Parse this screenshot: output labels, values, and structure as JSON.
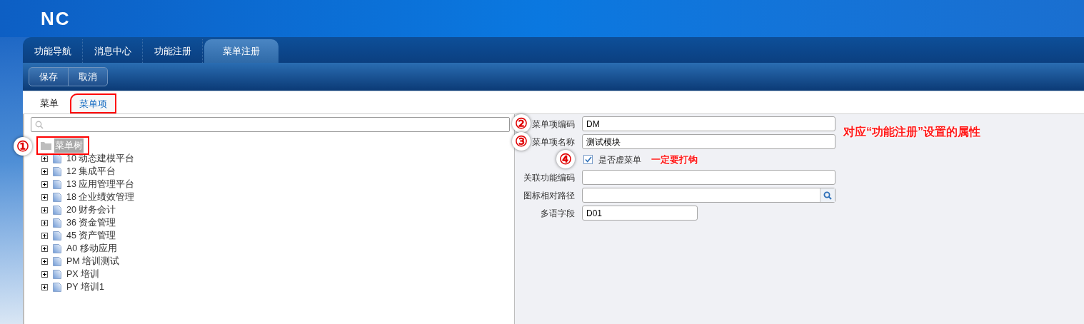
{
  "logo": "NC",
  "main_tabs": [
    {
      "label": "功能导航",
      "selected": false
    },
    {
      "label": "消息中心",
      "selected": false
    },
    {
      "label": "功能注册",
      "selected": false
    },
    {
      "label": "菜单注册",
      "selected": true
    }
  ],
  "toolbar": [
    "保存",
    "取消"
  ],
  "sub_tabs": [
    {
      "label": "菜单",
      "selected": false,
      "highlighted": false
    },
    {
      "label": "菜单项",
      "selected": true,
      "highlighted": true
    }
  ],
  "tree": {
    "root": {
      "label": "菜单树",
      "selected": true,
      "highlighted": true,
      "marker": "①"
    },
    "children": [
      {
        "code": "10",
        "label": "动态建模平台",
        "expanded": false
      },
      {
        "code": "12",
        "label": "集成平台",
        "expanded": false
      },
      {
        "code": "13",
        "label": "应用管理平台",
        "expanded": false
      },
      {
        "code": "18",
        "label": "企业绩效管理",
        "expanded": false
      },
      {
        "code": "20",
        "label": "财务会计",
        "expanded": false
      },
      {
        "code": "36",
        "label": "资金管理",
        "expanded": false
      },
      {
        "code": "45",
        "label": "资产管理",
        "expanded": false
      },
      {
        "code": "A0",
        "label": "移动应用",
        "expanded": false
      },
      {
        "code": "PM",
        "label": "培训测试",
        "expanded": false
      },
      {
        "code": "PX",
        "label": "培训",
        "expanded": false
      },
      {
        "code": "PY",
        "label": "培训1",
        "expanded": false
      }
    ]
  },
  "form": {
    "note": "对应“功能注册”设置的属性",
    "fields": [
      {
        "kind": "text",
        "label": "菜单项编码",
        "value": "DM",
        "marker": "②"
      },
      {
        "kind": "text",
        "label": "菜单项名称",
        "value": "测试模块",
        "marker": "③"
      },
      {
        "kind": "checkbox",
        "label": "是否虚菜单",
        "checked": true,
        "marker": "④",
        "note": "一定要打钩"
      },
      {
        "kind": "text",
        "label": "关联功能编码"
      },
      {
        "kind": "lookup",
        "label": "图标相对路径"
      },
      {
        "kind": "short",
        "label": "多语字段",
        "value": "D01"
      }
    ]
  }
}
